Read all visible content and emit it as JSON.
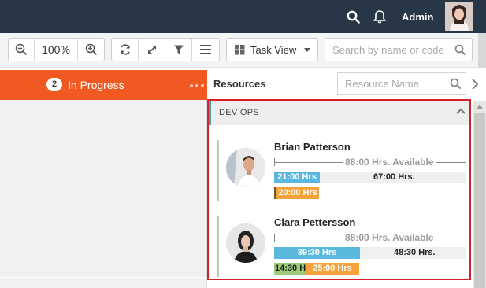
{
  "topbar": {
    "user_name": "Admin",
    "search_icon": "search-icon",
    "bell_icon": "bell-icon"
  },
  "toolbar": {
    "zoom_level": "100%",
    "view_label": "Task View",
    "search_placeholder": "Search by name or code"
  },
  "column": {
    "count": "2",
    "title": "In Progress"
  },
  "resources": {
    "title": "Resources",
    "search_placeholder": "Resource Name",
    "group": {
      "name": "DEV OPS",
      "people": [
        {
          "name": "Brian Patterson",
          "available": "88:00 Hrs. Available",
          "booked": "21:00 Hrs",
          "remaining": "67:00 Hrs.",
          "tasks": [
            {
              "label": "20:00 Hrs",
              "color": "#f5a23b"
            }
          ]
        },
        {
          "name": "Clara Pettersson",
          "available": "88:00 Hrs. Available",
          "booked": "39:30 Hrs",
          "remaining": "48:30 Hrs.",
          "tasks": [
            {
              "label": "14:30 Hrs",
              "color": "#9ccc7a"
            },
            {
              "label": "25:00 Hrs",
              "color": "#f5a23b"
            }
          ]
        }
      ]
    }
  },
  "colors": {
    "topbar": "#283747",
    "accent_orange": "#f05a22",
    "highlight_border": "#d9202a",
    "booked_blue": "#5ab8df"
  }
}
